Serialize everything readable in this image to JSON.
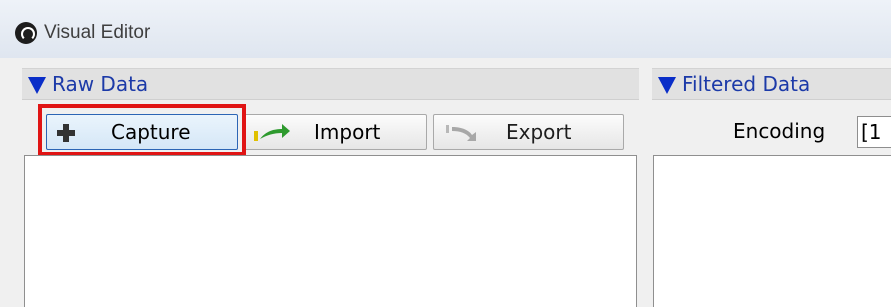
{
  "window": {
    "title": "Visual Editor",
    "icon": "app-logo-icon"
  },
  "raw_data": {
    "title": "Raw Data",
    "buttons": {
      "capture": {
        "label": "Capture",
        "icon": "plus-icon"
      },
      "import": {
        "label": "Import",
        "icon": "import-arrow-icon"
      },
      "export": {
        "label": "Export",
        "icon": "export-arrow-icon"
      }
    }
  },
  "filtered_data": {
    "title": "Filtered Data",
    "encoding_label": "Encoding",
    "encoding_value": "[1"
  },
  "colors": {
    "section_title": "#1c3aa8",
    "triangle": "#0a2ec8",
    "highlight": "#e01414",
    "import_arrow": "#2e9a2e"
  }
}
